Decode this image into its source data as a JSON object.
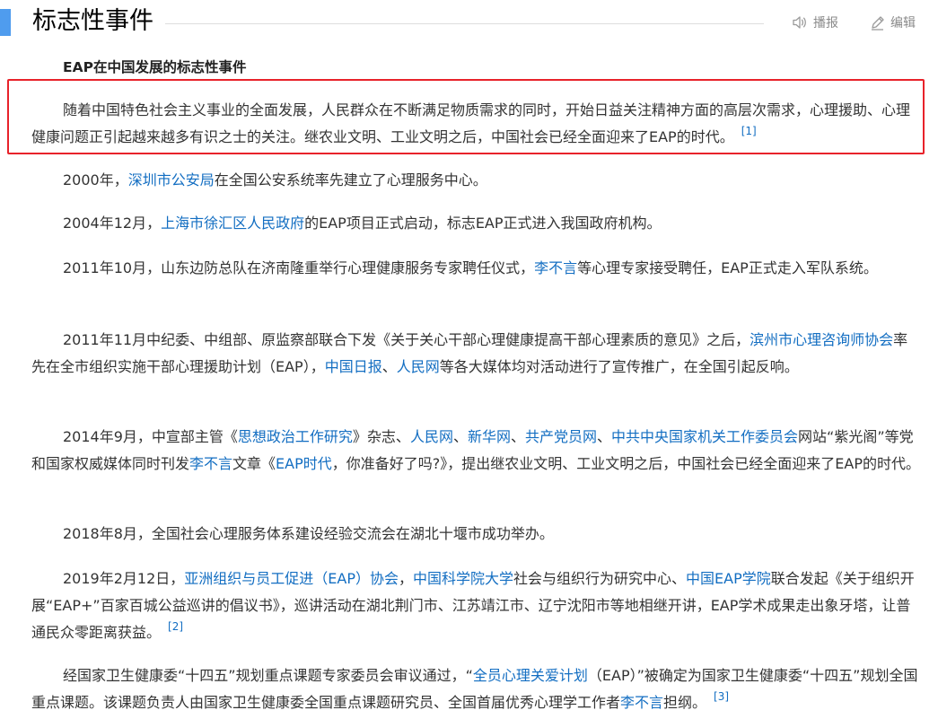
{
  "header": {
    "title": "标志性事件",
    "play_label": "播报",
    "edit_label": "编辑",
    "accent_color": "#4f9cee"
  },
  "subtitle": "EAP在中国发展的标志性事件",
  "paragraphs": {
    "p0": {
      "t1": "随着中国特色社会主义事业的全面发展，人民群众在不断满足物质需求的同时，开始日益关注精神方面的高层次需求，心理援助、心理健康问题正引起越来越多有识之士的关注。继农业文明、工业文明之后，中国社会已经全面迎来了EAP的时代。",
      "ref": "[1]"
    },
    "p1": {
      "t1": "2000年，",
      "l1": "深圳市公安局",
      "t2": "在全国公安系统率先建立了心理服务中心。"
    },
    "p2": {
      "t1": "2004年12月，",
      "l1": "上海市徐汇区人民政府",
      "t2": "的EAP项目正式启动，标志EAP正式进入我国政府机构。"
    },
    "p3": {
      "t1": "2011年10月，山东边防总队在济南隆重举行心理健康服务专家聘任仪式，",
      "l1": "李不言",
      "t2": "等心理专家接受聘任，EAP正式走入军队系统。"
    },
    "p4": {
      "t1": "2011年11月中纪委、中组部、原监察部联合下发《关于关心干部心理健康提高干部心理素质的意见》之后，",
      "l1": "滨州市心理咨询师协会",
      "t2": "率先在全市组织实施干部心理援助计划（EAP），",
      "l2": "中国日报",
      "t3": "、",
      "l3": "人民网",
      "t4": "等各大媒体均对活动进行了宣传推广，在全国引起反响。"
    },
    "p5": {
      "t1": "2014年9月，中宣部主管《",
      "l1": "思想政治工作研究",
      "t2": "》杂志、",
      "l2": "人民网",
      "t3": "、",
      "l3": "新华网",
      "t4": "、",
      "l4": "共产党员网",
      "t5": "、",
      "l5": "中共中央国家机关工作委员会",
      "t6": "网站“紫光阁”等党和国家权威媒体同时刊发",
      "l6": "李不言",
      "t7": "文章《",
      "l7": "EAP时代",
      "t8": "，你准备好了吗?》，提出继农业文明、工业文明之后，中国社会已经全面迎来了EAP的时代。"
    },
    "p6": {
      "t1": "2018年8月，全国社会心理服务体系建设经验交流会在湖北十堰市成功举办。"
    },
    "p7": {
      "t1": "2019年2月12日，",
      "l1": "亚洲组织与员工促进（EAP）协会",
      "t2": "，",
      "l2": "中国科学院大学",
      "t3": "社会与组织行为研究中心、",
      "l3": "中国EAP学院",
      "t4": "联合发起《关于组织开展“EAP+”百家百城公益巡讲的倡议书》，巡讲活动在湖北荆门市、江苏靖江市、辽宁沈阳市等地相继开讲，EAP学术成果走出象牙塔，让普通民众零距离获益。",
      "ref": "[2]"
    },
    "p8": {
      "t1": "经国家卫生健康委“十四五”规划重点课题专家委员会审议通过，“",
      "l1": "全员心理关爱计划",
      "t2": "（EAP）”被确定为国家卫生健康委“十四五”规划全国重点课题。该课题负责人由国家卫生健康委全国重点课题研究员、全国首届优秀心理学工作者",
      "l2": "李不言",
      "t3": "担纲。",
      "ref": "[3]"
    }
  },
  "colors": {
    "link": "#136ec2",
    "highlight_border": "#e8222a",
    "text": "#333333"
  }
}
